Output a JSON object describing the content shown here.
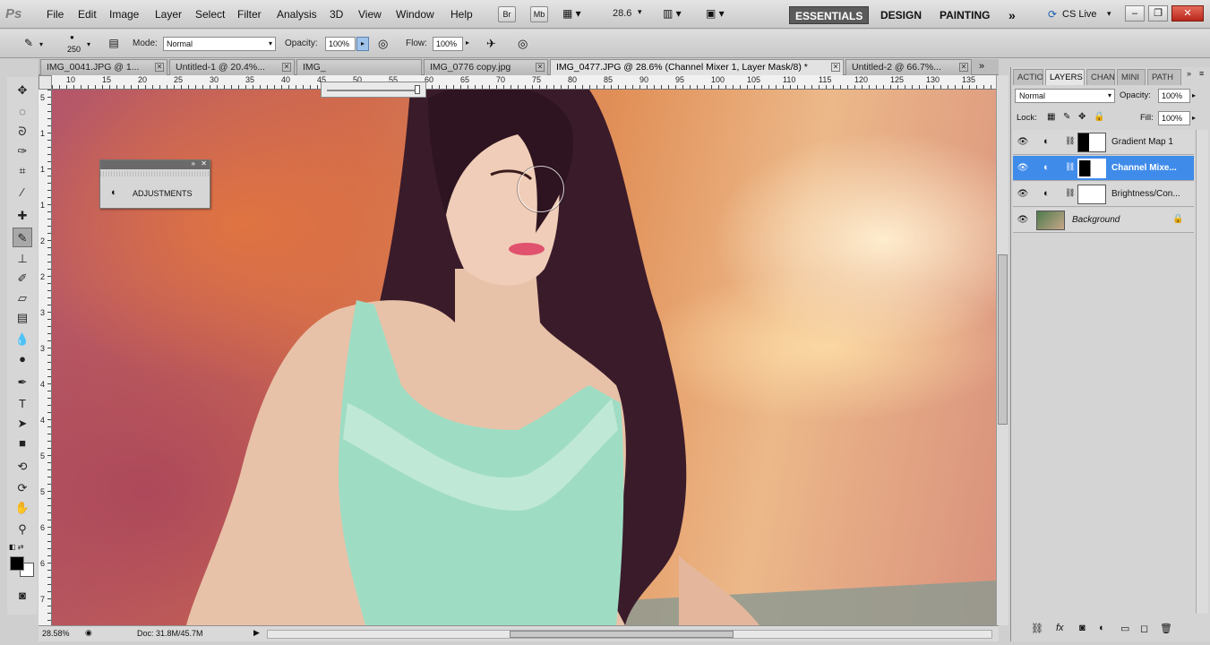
{
  "app": {
    "logo": "Ps"
  },
  "menu": [
    "File",
    "Edit",
    "Image",
    "Layer",
    "Select",
    "Filter",
    "Analysis",
    "3D",
    "View",
    "Window",
    "Help"
  ],
  "appbar": {
    "br_label": "Br",
    "mb_label": "Mb",
    "zoom": "28.6",
    "workspaces": [
      "ESSENTIALS",
      "DESIGN",
      "PAINTING"
    ],
    "more": "»",
    "cslive": "CS Live"
  },
  "options": {
    "brush_size": "250",
    "mode_label": "Mode:",
    "mode_value": "Normal",
    "opacity_label": "Opacity:",
    "opacity_value": "100%",
    "flow_label": "Flow:",
    "flow_value": "100%"
  },
  "tabs": [
    {
      "label": "IMG_0041.JPG @ 1..."
    },
    {
      "label": "Untitled-1 @ 20.4%..."
    },
    {
      "label": "IMG_"
    },
    {
      "label": "IMG_0776 copy.jpg"
    },
    {
      "label": "IMG_0477.JPG @ 28.6% (Channel Mixer 1, Layer Mask/8) *"
    },
    {
      "label": "Untitled-2 @ 66.7%..."
    }
  ],
  "ruler_h": [
    "10",
    "15",
    "20",
    "25",
    "30",
    "35",
    "40",
    "45",
    "50",
    "55",
    "60",
    "65",
    "70",
    "75",
    "80",
    "85",
    "90",
    "95",
    "100",
    "105",
    "110",
    "115",
    "120",
    "125",
    "130",
    "135"
  ],
  "ruler_v": [
    "5",
    "1",
    "1",
    "1",
    "2",
    "2",
    "3",
    "3",
    "4",
    "4",
    "5",
    "5",
    "6",
    "6",
    "7"
  ],
  "adjustments": {
    "title": "ADJUSTMENTS"
  },
  "status": {
    "zoom": "28.58%",
    "doc": "Doc: 31.8M/45.7M"
  },
  "panel": {
    "tabs": [
      "ACTIO",
      "LAYERS",
      "CHAN",
      "MINI",
      "PATH"
    ],
    "blend_mode": "Normal",
    "opacity_label": "Opacity:",
    "opacity_value": "100%",
    "lock_label": "Lock:",
    "fill_label": "Fill:",
    "fill_value": "100%",
    "layers": [
      {
        "name": "Gradient Map 1"
      },
      {
        "name": "Channel Mixe..."
      },
      {
        "name": "Brightness/Con..."
      },
      {
        "name": "Background"
      }
    ]
  },
  "colors": {
    "selection": "#3f8bea",
    "foreground": "#000000",
    "background": "#ffffff"
  }
}
